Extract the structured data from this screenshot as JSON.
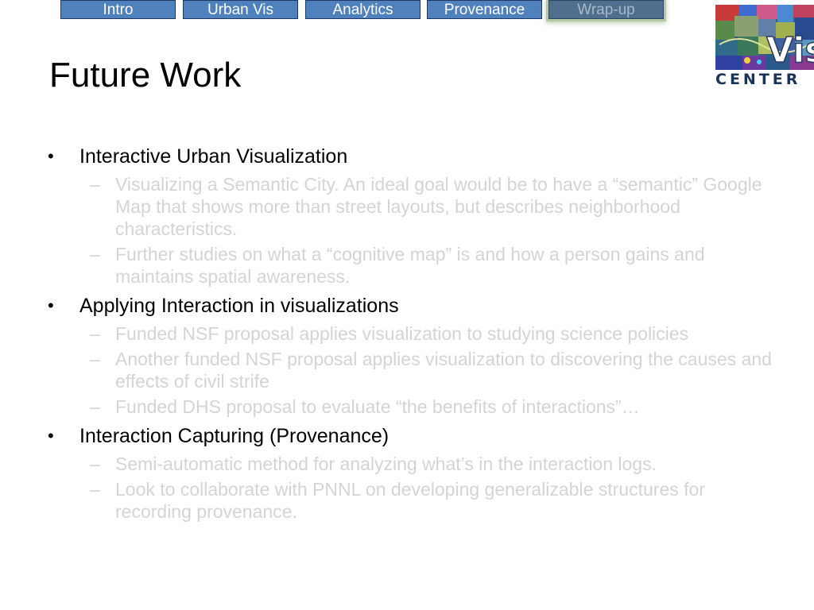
{
  "nav": {
    "tabs": [
      {
        "label": "Intro",
        "active": false
      },
      {
        "label": "Urban Vis",
        "active": false
      },
      {
        "label": "Analytics",
        "active": false
      },
      {
        "label": "Provenance",
        "active": false
      },
      {
        "label": "Wrap-up",
        "active": true
      }
    ]
  },
  "title": "Future Work",
  "logo": {
    "text": "CENTER",
    "overlay": "Vis"
  },
  "bullets": [
    {
      "text": "Interactive Urban Visualization",
      "subitems": [
        "Visualizing a Semantic City.  An ideal goal would be to have a “semantic” Google Map that shows more than street layouts, but describes neighborhood characteristics.",
        "Further studies on what a “cognitive map” is and how a person gains and maintains spatial awareness."
      ]
    },
    {
      "text": "Applying Interaction in visualizations",
      "subitems": [
        "Funded NSF proposal applies visualization to studying science policies",
        "Another funded NSF proposal applies visualization to discovering the causes and effects of civil strife",
        "Funded DHS proposal to evaluate “the benefits of interactions”…"
      ]
    },
    {
      "text": "Interaction Capturing (Provenance)",
      "subitems": [
        "Semi-automatic method for analyzing what’s in the interaction logs.",
        "Look to collaborate with PNNL on developing generalizable structures for recording provenance."
      ]
    }
  ],
  "colors": {
    "tab_bg": "#4f81bd",
    "tab_active_glow": "#b4c8a4",
    "subtext": "#d4d4d4",
    "logo_text": "#1a3358"
  }
}
